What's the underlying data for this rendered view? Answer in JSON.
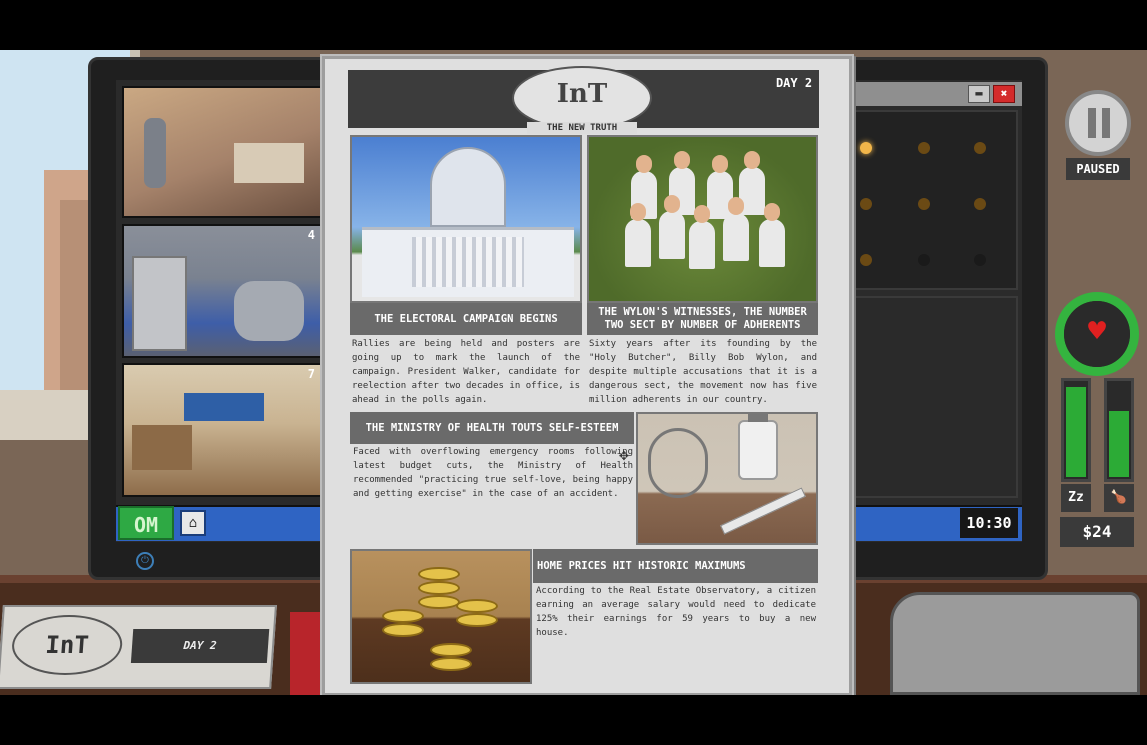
{
  "desktop": {
    "cameras": [
      {
        "number": ""
      },
      {
        "number": "4"
      },
      {
        "number": "7"
      }
    ],
    "taskbar": {
      "start_label": "OM",
      "clock": "10:30"
    },
    "app_window": {
      "minimize_glyph": "▬",
      "close_glyph": "✖"
    }
  },
  "hud": {
    "paused_label": "PAUSED",
    "money": "$24",
    "sleep_icon_glyph": "Zz",
    "food_icon_glyph": "🍗",
    "heart_glyph": "♥",
    "health_fraction": 0.85,
    "sleep_fraction": 0.98,
    "food_fraction": 0.72,
    "colors": {
      "health": "#34b43f",
      "heart": "#e02020"
    }
  },
  "desk_newspaper": {
    "logo": "InT",
    "day": "DAY 2"
  },
  "newspaper": {
    "logo": "InT",
    "subtitle": "THE NEW TRUTH",
    "day": "DAY 2",
    "articles": [
      {
        "headline": "THE ELECTORAL CAMPAIGN BEGINS",
        "body": "Rallies are being held and posters are going up to mark the launch of the campaign. President Walker, candidate for reelection after two decades in office, is ahead in the polls again."
      },
      {
        "headline": "THE WYLON'S WITNESSES, THE NUMBER TWO SECT BY NUMBER OF ADHERENTS",
        "body": "Sixty years after its founding by the \"Holy Butcher\", Billy Bob Wylon, and despite multiple accusations that it is a dangerous sect, the movement now has five million adherents in our country."
      },
      {
        "headline": "THE MINISTRY OF HEALTH TOUTS SELF-ESTEEM",
        "body": "Faced with overflowing emergency rooms following latest budget cuts, the Ministry of Health recommended \"practicing true self-love, being happy and getting exercise\" in the case of an accident."
      },
      {
        "headline": "HOME PRICES HIT HISTORIC MAXIMUMS",
        "body": "According to the Real Estate Observatory, a citizen earning an average salary would need to dedicate 125% their earnings for 59 years to buy a new house."
      }
    ]
  }
}
